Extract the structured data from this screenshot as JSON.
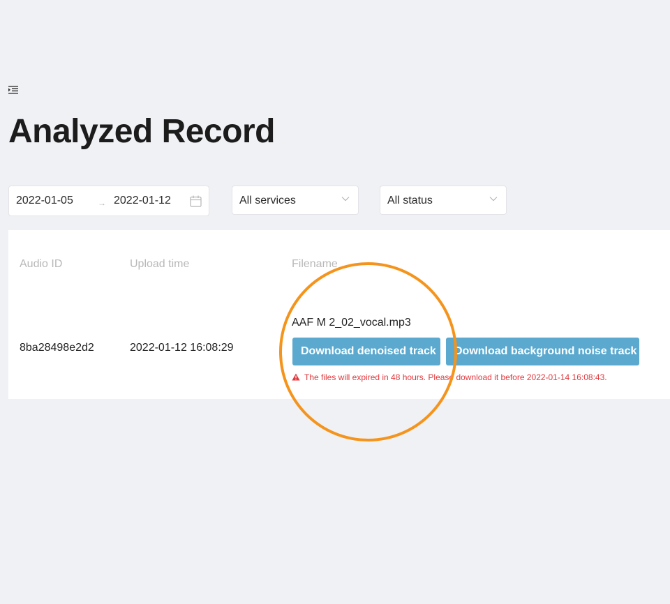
{
  "page": {
    "title": "Analyzed Record",
    "menu_icon": "indent-menu-icon"
  },
  "filters": {
    "date_range": {
      "start": "2022-01-05",
      "end": "2022-01-12",
      "separator": "→",
      "icon": "calendar-icon"
    },
    "services": {
      "value": "All services",
      "icon": "chevron-down-icon"
    },
    "status": {
      "value": "All status",
      "icon": "chevron-down-icon"
    }
  },
  "table": {
    "columns": [
      "Audio ID",
      "Upload time",
      "Filename"
    ],
    "rows": [
      {
        "audio_id": "8ba28498e2d2",
        "upload_time": "2022-01-12 16:08:29",
        "filename": "AAF M 2_02_vocal.mp3",
        "actions": {
          "denoised": "Download denoised track",
          "background": "Download background noise track"
        },
        "warning": "The files will expired in 48 hours. Please download it before 2022-01-14 16:08:43."
      }
    ]
  },
  "colors": {
    "background": "#f0f1f5",
    "button": "#5ba9cf",
    "warning": "#e0393e",
    "highlight": "#f5941c"
  }
}
